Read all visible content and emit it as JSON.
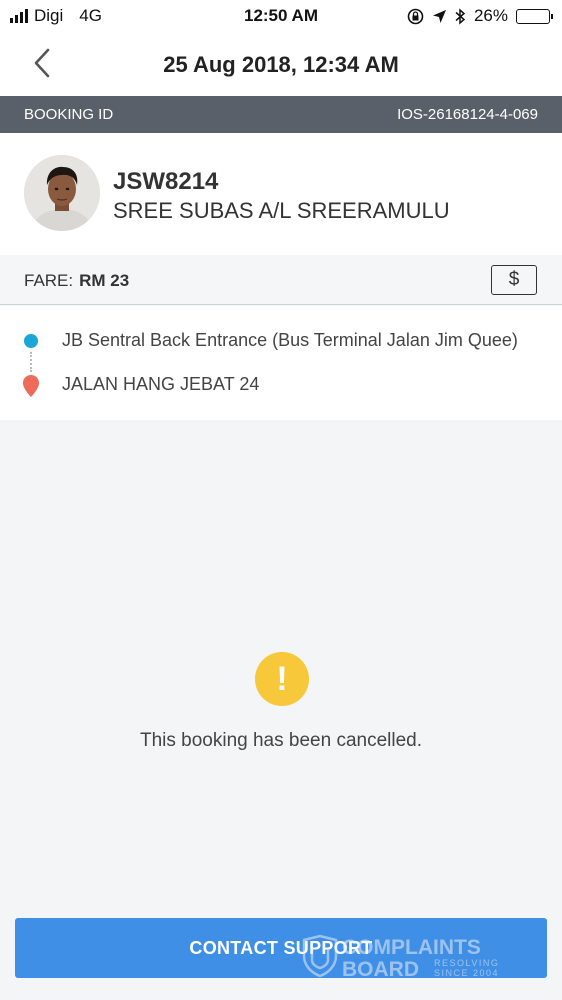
{
  "status_bar": {
    "carrier": "Digi",
    "network": "4G",
    "time": "12:50 AM",
    "battery": "26%",
    "battery_level": 0.26
  },
  "header": {
    "title": "25 Aug 2018, 12:34 AM"
  },
  "booking": {
    "label": "BOOKING ID",
    "id": "IOS-26168124-4-069"
  },
  "driver": {
    "plate": "JSW8214",
    "name": "SREE SUBAS A/L SREERAMULU"
  },
  "fare": {
    "label": "FARE:",
    "amount": "RM 23",
    "payment_icon": "$"
  },
  "route": {
    "pickup": "JB Sentral Back Entrance (Bus Terminal Jalan Jim Quee)",
    "dropoff": "JALAN HANG JEBAT 24"
  },
  "status": {
    "icon": "!",
    "message": "This booking has been cancelled."
  },
  "actions": {
    "contact_support": "CONTACT SUPPORT"
  },
  "watermark": {
    "line1": "COMPLAINTS",
    "line2": "BOARD",
    "tag1": "RESOLVING",
    "tag2": "SINCE 2004"
  },
  "colors": {
    "accent": "#3f8fe6",
    "pickup_dot": "#1aa6d8",
    "dropoff_pin": "#ee6a5a",
    "warning": "#f6c83a",
    "booking_bar": "#5a606a"
  }
}
